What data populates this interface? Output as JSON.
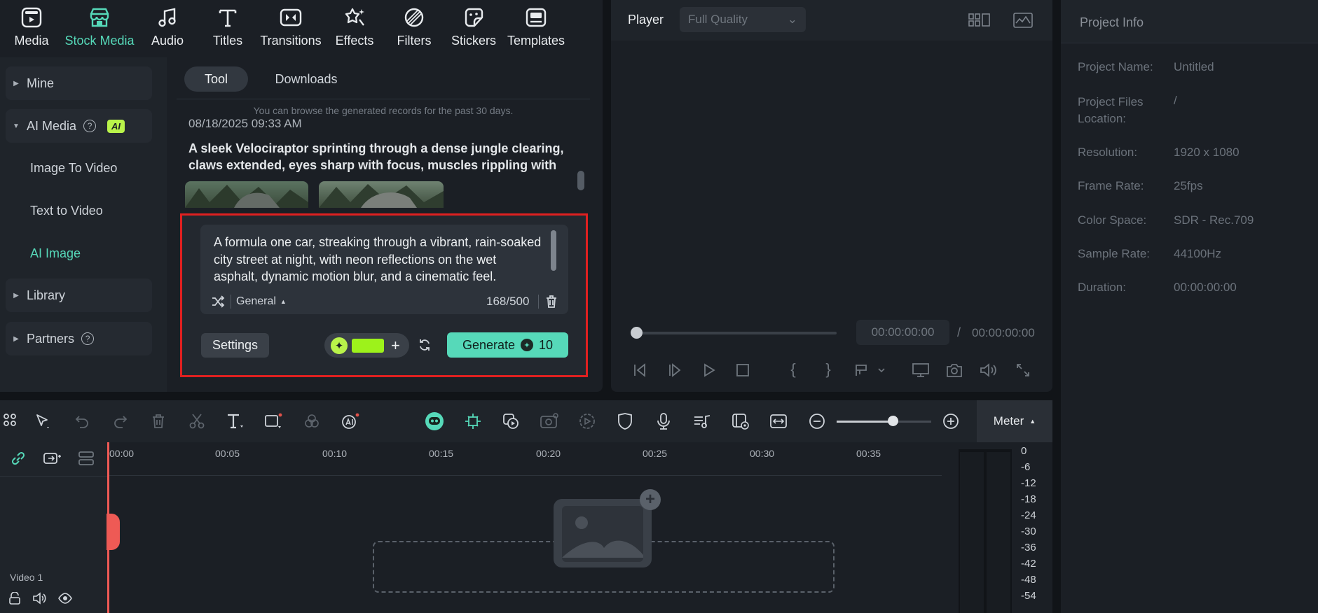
{
  "tabs": [
    {
      "label": "Media",
      "icon": "media-icon"
    },
    {
      "label": "Stock Media",
      "icon": "stock-media-icon",
      "active": true
    },
    {
      "label": "Audio",
      "icon": "audio-icon"
    },
    {
      "label": "Titles",
      "icon": "titles-icon"
    },
    {
      "label": "Transitions",
      "icon": "transitions-icon"
    },
    {
      "label": "Effects",
      "icon": "effects-icon"
    },
    {
      "label": "Filters",
      "icon": "filters-icon"
    },
    {
      "label": "Stickers",
      "icon": "stickers-icon"
    },
    {
      "label": "Templates",
      "icon": "templates-icon"
    }
  ],
  "sidebar": {
    "mine": "Mine",
    "ai_media": "AI Media",
    "ai_badge": "AI",
    "image_to_video": "Image To Video",
    "text_to_video": "Text to Video",
    "ai_image": "AI Image",
    "library": "Library",
    "partners": "Partners"
  },
  "content": {
    "tab_tool": "Tool",
    "tab_downloads": "Downloads",
    "notice": "You can browse the generated records for the past 30 days.",
    "record_date": "08/18/2025 09:33 AM",
    "record_text": "A sleek Velociraptor sprinting through a dense jungle clearing, claws extended, eyes sharp with focus, muscles rippling with spe...",
    "prompt_text": "A formula one car, streaking through a vibrant, rain-soaked city street at night, with neon reflections on the wet asphalt, dynamic motion blur, and a cinematic feel.",
    "style_label": "General",
    "char_count": "168/500",
    "settings_label": "Settings",
    "generate_label": "Generate",
    "generate_cost": "10",
    "accent": "#56d9b9",
    "highlight": "#e02020"
  },
  "player": {
    "label": "Player",
    "quality": "Full Quality",
    "current_time": "00:00:00:00",
    "separator": "/",
    "total_time": "00:00:00:00"
  },
  "project_info": {
    "title": "Project Info",
    "rows": [
      {
        "label": "Project Name:",
        "value": "Untitled"
      },
      {
        "label": "Project Files Location:",
        "value": "/"
      },
      {
        "label": "Resolution:",
        "value": "1920 x 1080"
      },
      {
        "label": "Frame Rate:",
        "value": "25fps"
      },
      {
        "label": "Color Space:",
        "value": "SDR - Rec.709"
      },
      {
        "label": "Sample Rate:",
        "value": "44100Hz"
      },
      {
        "label": "Duration:",
        "value": "00:00:00:00"
      }
    ]
  },
  "timeline": {
    "meter_label": "Meter",
    "ticks": [
      "00:00",
      "00:05",
      "00:10",
      "00:15",
      "00:20",
      "00:25",
      "00:30",
      "00:35"
    ],
    "db_scale": [
      "0",
      "-6",
      "-12",
      "-18",
      "-24",
      "-30",
      "-36",
      "-42",
      "-48",
      "-54"
    ],
    "track_label": "Video 1"
  }
}
